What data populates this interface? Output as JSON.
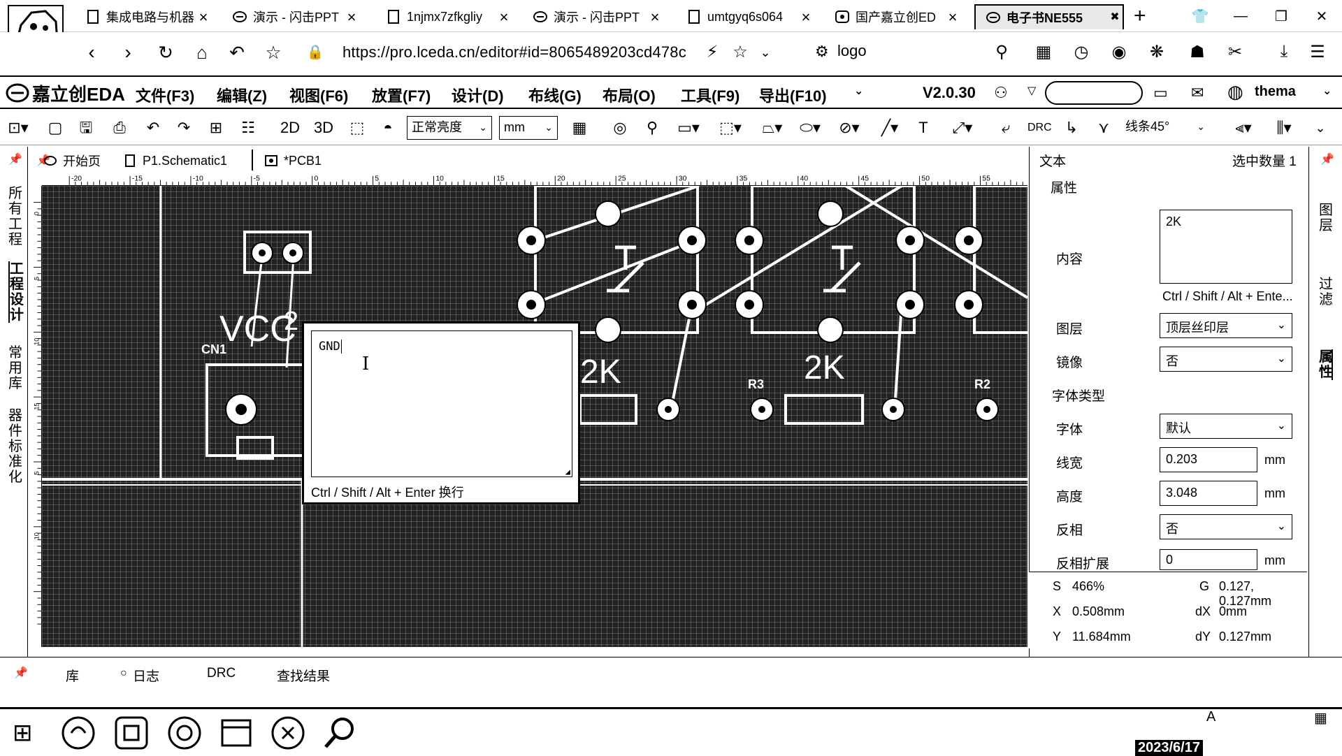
{
  "browser": {
    "tabs": [
      {
        "label": "集成电路与机器",
        "icon": "doc-icon"
      },
      {
        "label": "演示 - 闪击PPT",
        "icon": "flash-icon"
      },
      {
        "label": "1njmx7zfkgliy",
        "icon": "doc-icon"
      },
      {
        "label": "演示 - 闪击PPT",
        "icon": "flash-icon"
      },
      {
        "label": "umtgyq6s064",
        "icon": "doc-icon"
      },
      {
        "label": "国产嘉立创ED",
        "icon": "lceda-icon"
      },
      {
        "label": "电子书NE555",
        "icon": "flash-icon"
      }
    ],
    "url": "https://pro.lceda.cn/editor#id=8065489203cd478c",
    "logo_button": "logo"
  },
  "app": {
    "logo": "嘉立创EDA",
    "menu": [
      "文件(F3)",
      "编辑(Z)",
      "视图(F6)",
      "放置(F7)",
      "设计(D)",
      "布线(G)",
      "布局(O)",
      "工具(F9)",
      "导出(F10)"
    ],
    "version": "V2.0.30",
    "username": "thema"
  },
  "toolbar": {
    "mode_2d": "2D",
    "mode_3d": "3D",
    "brightness": "正常亮度",
    "unit": "mm",
    "drc": "DRC",
    "route_angle": "线条45°"
  },
  "left_tabs": [
    "所有工程",
    "工程设计",
    "常用库",
    "器件标准化"
  ],
  "doc_tabs": [
    {
      "label": "开始页",
      "icon": "home-icon"
    },
    {
      "label": "P1.Schematic1",
      "icon": "schematic-icon"
    },
    {
      "label": "*PCB1",
      "icon": "pcb-icon"
    }
  ],
  "ruler": [
    "-20",
    "-15",
    "-10",
    "-5",
    "0",
    "5",
    "10",
    "15",
    "20",
    "25",
    "30",
    "35",
    "40",
    "45",
    "50",
    "55"
  ],
  "ruler_left": [
    "0",
    "5",
    "10",
    "15",
    "5",
    "10"
  ],
  "canvas": {
    "labels": {
      "vcc": "VCC",
      "cn1": "CN1",
      "r3": "R3",
      "r2": "R2",
      "k2a": "2K",
      "k2b": "2K",
      "two": "2"
    }
  },
  "text_editor": {
    "value": "GND",
    "hint": "Ctrl / Shift / Alt + Enter 换行"
  },
  "props": {
    "title": "文本",
    "selected": "选中数量 1",
    "section": "属性",
    "content_label": "内容",
    "content_value": "2K",
    "content_hint": "Ctrl / Shift / Alt + Ente...",
    "layer_label": "图层",
    "layer_value": "顶层丝印层",
    "mirror_label": "镜像",
    "mirror_value": "否",
    "font_type_label": "字体类型",
    "font_label": "字体",
    "font_value": "默认",
    "linewidth_label": "线宽",
    "linewidth_value": "0.203",
    "height_label": "高度",
    "height_value": "3.048",
    "invert_label": "反相",
    "invert_value": "否",
    "invert_ext_label": "反相扩展",
    "invert_ext_value": "0",
    "unit": "mm"
  },
  "status": {
    "s_label": "S",
    "s_value": "466%",
    "g_label": "G",
    "g_value": "0.127, 0.127mm",
    "x_label": "X",
    "x_value": "0.508mm",
    "dx_label": "dX",
    "dx_value": "0mm",
    "y_label": "Y",
    "y_value": "11.684mm",
    "dy_label": "dY",
    "dy_value": "0.127mm"
  },
  "right_tabs": [
    "图层",
    "过滤",
    "属性"
  ],
  "bottom_tabs": [
    "库",
    "日志",
    "DRC",
    "查找结果"
  ],
  "taskbar": {
    "date": "2023/6/17"
  }
}
